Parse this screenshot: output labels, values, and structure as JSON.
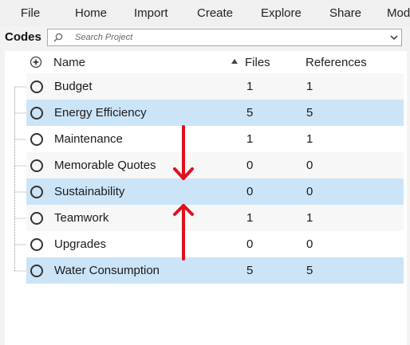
{
  "menu": {
    "items": [
      {
        "label": "File"
      },
      {
        "label": "Home"
      },
      {
        "label": "Import"
      },
      {
        "label": "Create"
      },
      {
        "label": "Explore"
      },
      {
        "label": "Share"
      },
      {
        "label": "Mod"
      }
    ]
  },
  "codes": {
    "label": "Codes",
    "search_placeholder": "Search Project"
  },
  "table": {
    "columns": {
      "name": "Name",
      "files": "Files",
      "references": "References"
    },
    "rows": [
      {
        "name": "Budget",
        "files": "1",
        "references": "1"
      },
      {
        "name": "Energy Efficiency",
        "files": "5",
        "references": "5"
      },
      {
        "name": "Maintenance",
        "files": "1",
        "references": "1"
      },
      {
        "name": "Memorable Quotes",
        "files": "0",
        "references": "0"
      },
      {
        "name": "Sustainability",
        "files": "0",
        "references": "0"
      },
      {
        "name": "Teamwork",
        "files": "1",
        "references": "1"
      },
      {
        "name": "Upgrades",
        "files": "0",
        "references": "0"
      },
      {
        "name": "Water Consumption",
        "files": "5",
        "references": "5"
      }
    ]
  },
  "colors": {
    "selected_row": "#cce4f7",
    "arrow": "#e0101e"
  }
}
